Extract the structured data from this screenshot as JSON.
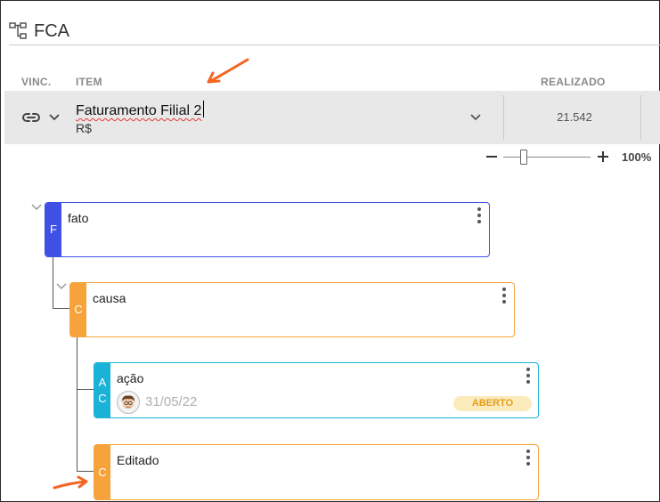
{
  "app": {
    "title": "FCA",
    "logo_icon": "hierarchy-icon"
  },
  "table": {
    "headers": {
      "vinc": "VINC.",
      "item": "ITEM",
      "realizado": "REALIZADO"
    },
    "row": {
      "item_name": "Faturamento Filial 2",
      "unit": "R$",
      "realizado_value": "21.542"
    }
  },
  "zoom": {
    "level": "100%",
    "slider_value_fraction": 0.2
  },
  "tree": {
    "fato": {
      "letter": "F",
      "text": "fato",
      "color": "#3f51e5"
    },
    "causa": {
      "letter": "C",
      "text": "causa",
      "color": "#f5a33a"
    },
    "acao": {
      "letters": [
        "A",
        "C"
      ],
      "text": "ação",
      "date": "31/05/22",
      "status": "ABERTO",
      "color": "#1ab2d6"
    },
    "editado": {
      "letter": "C",
      "text": "Editado",
      "color": "#f5a33a"
    }
  },
  "colors": {
    "annotation_arrow": "#f26522",
    "row_background": "#e8e8e8"
  }
}
